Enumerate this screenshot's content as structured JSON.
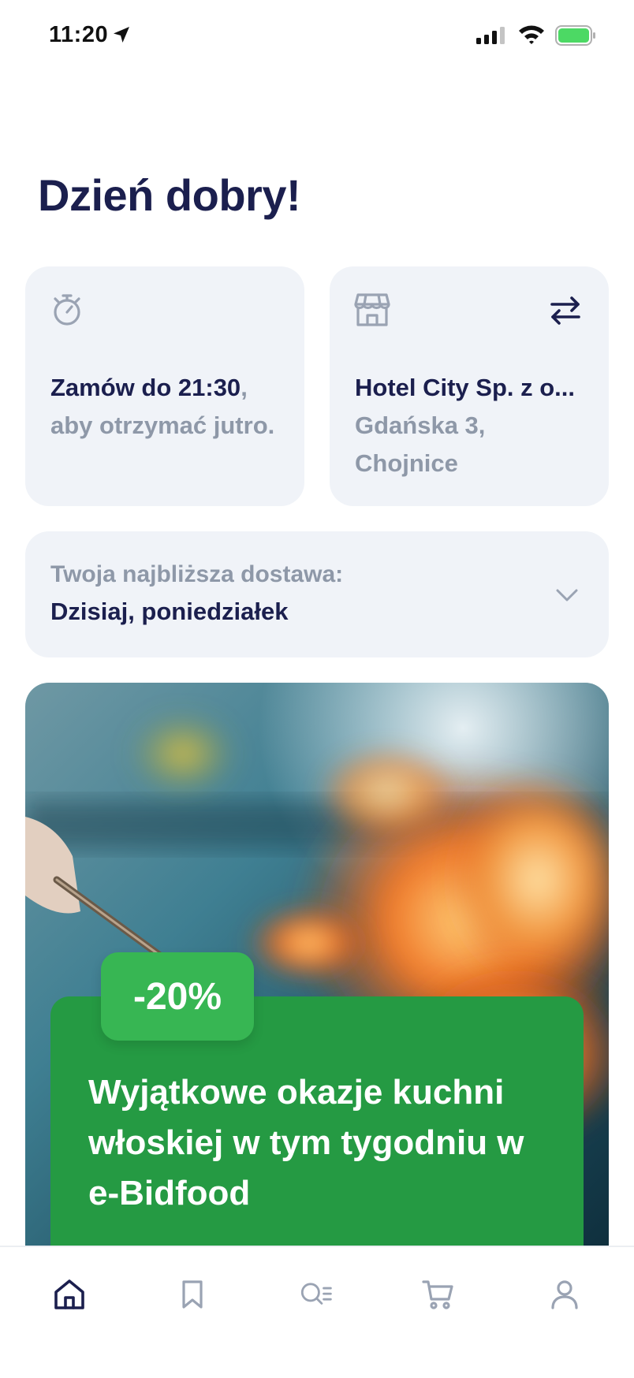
{
  "status_bar": {
    "time": "11:20"
  },
  "greeting": "Dzień dobry!",
  "order_card": {
    "deadline": "Zamów do 21:30",
    "comma": ",",
    "rest": "aby otrzymać jutro.",
    "icon": "stopwatch-icon"
  },
  "store_card": {
    "name": "Hotel City Sp. z o...",
    "address": "Gdańska 3, Chojnice",
    "icons": [
      "store-icon",
      "switch-icon"
    ]
  },
  "delivery": {
    "label": "Twoja najbliższa dostawa:",
    "value": "Dzisiaj, poniedziałek"
  },
  "promo": {
    "badge": "-20%",
    "title": "Wyjątkowe okazje kuchni włoskiej w tym tygodniu w e-Bidfood"
  },
  "tabbar": {
    "items": [
      "home-icon",
      "bookmark-icon",
      "search-list-icon",
      "cart-icon",
      "profile-icon"
    ],
    "active": "home-icon"
  },
  "colors": {
    "primary": "#1b1f4e",
    "muted": "#8e98a8",
    "card_bg": "#f0f3f8",
    "promo_green": "#259a43",
    "badge_green": "#37b653"
  }
}
